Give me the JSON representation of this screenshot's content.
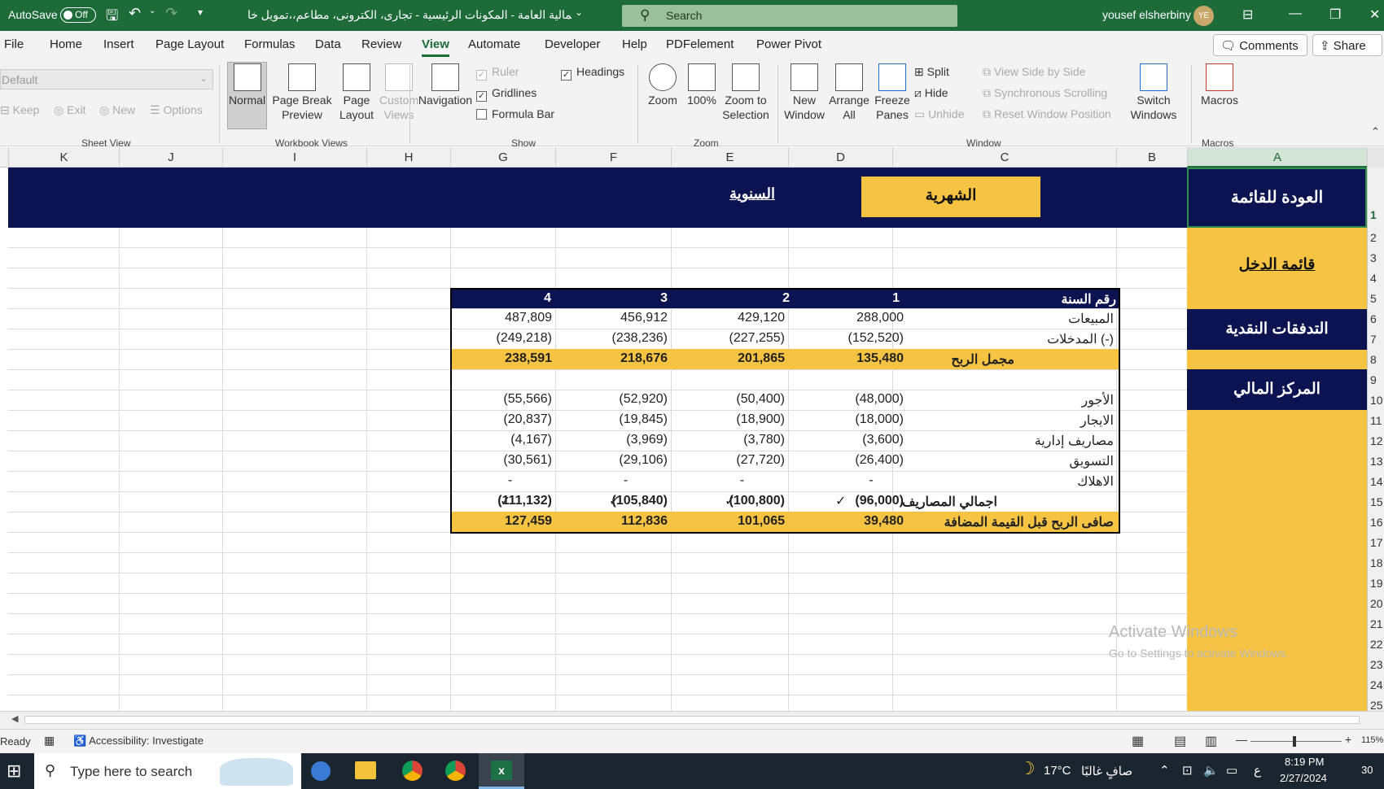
{
  "titlebar": {
    "autosave_label": "AutoSave",
    "autosave_state": "Off",
    "doc_title": "المالية العامة - المكونات الرئيسية - تجارى، الكترونى، مطاعم،،تمويل خا...",
    "search_placeholder": "Search",
    "user_name": "yousef elsherbiny",
    "user_initials": "YE"
  },
  "menu": {
    "tabs": [
      "File",
      "Home",
      "Insert",
      "Page Layout",
      "Formulas",
      "Data",
      "Review",
      "View",
      "Automate",
      "Developer",
      "Help",
      "PDFelement",
      "Power Pivot"
    ],
    "active_tab": "View",
    "comments_label": "Comments",
    "share_label": "Share"
  },
  "ribbon": {
    "sheet_view": {
      "dropdown_value": "Default",
      "keep": "Keep",
      "exit": "Exit",
      "new": "New",
      "options": "Options",
      "group": "Sheet View"
    },
    "workbook_views": {
      "normal": "Normal",
      "page_break": "Page Break\nPreview",
      "page_layout": "Page\nLayout",
      "custom_views": "Custom\nViews",
      "group": "Workbook Views"
    },
    "show": {
      "navigation": "Navigation",
      "ruler": "Ruler",
      "gridlines": "Gridlines",
      "formula_bar": "Formula Bar",
      "headings": "Headings",
      "group": "Show"
    },
    "zoom": {
      "zoom": "Zoom",
      "zoom100": "100%",
      "zoom_sel": "Zoom to\nSelection",
      "group": "Zoom"
    },
    "window": {
      "new_window": "New\nWindow",
      "arrange_all": "Arrange\nAll",
      "freeze": "Freeze\nPanes",
      "split": "Split",
      "hide": "Hide",
      "unhide": "Unhide",
      "side_by_side": "View Side by Side",
      "sync_scroll": "Synchronous Scrolling",
      "reset_pos": "Reset Window Position",
      "switch": "Switch\nWindows",
      "group": "Window"
    },
    "macros": {
      "macros": "Macros",
      "group": "Macros"
    }
  },
  "columns": [
    "K",
    "J",
    "I",
    "H",
    "G",
    "F",
    "E",
    "D",
    "C",
    "B",
    "A"
  ],
  "rows": [
    "1",
    "2",
    "3",
    "4",
    "5",
    "6",
    "7",
    "8",
    "9",
    "10",
    "11",
    "12",
    "13",
    "14",
    "15",
    "16",
    "17",
    "18",
    "19",
    "20",
    "21",
    "22",
    "23",
    "24",
    "25"
  ],
  "sheet": {
    "back_to_list": "العودة للقائمة",
    "monthly": "الشهرية",
    "annual": "السنوية",
    "nav_income": "قائمة الدخل",
    "nav_cashflow": "التدفقات النقدية",
    "nav_position": "المركز المالي"
  },
  "table": {
    "header_label": "رقم السنة",
    "years": [
      "1",
      "2",
      "3",
      "4"
    ],
    "rows": [
      {
        "label": "المبيعات",
        "values": [
          "288,000",
          "429,120",
          "456,912",
          "487,809"
        ],
        "style": "normal"
      },
      {
        "label": "المدخلات (-)",
        "values": [
          "(152,520)",
          "(227,255)",
          "(238,236)",
          "(249,218)"
        ],
        "style": "normal"
      },
      {
        "label": "مجمل الربح",
        "values": [
          "135,480",
          "201,865",
          "218,676",
          "238,591"
        ],
        "style": "highlight"
      },
      {
        "label": "",
        "values": [
          "",
          "",
          "",
          ""
        ],
        "style": "blank"
      },
      {
        "label": "الأجور",
        "values": [
          "(48,000)",
          "(50,400)",
          "(52,920)",
          "(55,566)"
        ],
        "style": "normal"
      },
      {
        "label": "الايجار",
        "values": [
          "(18,000)",
          "(18,900)",
          "(19,845)",
          "(20,837)"
        ],
        "style": "normal"
      },
      {
        "label": "مصاريف إدارية",
        "values": [
          "(3,600)",
          "(3,780)",
          "(3,969)",
          "(4,167)"
        ],
        "style": "normal"
      },
      {
        "label": "التسويق",
        "values": [
          "(26,400)",
          "(27,720)",
          "(29,106)",
          "(30,561)"
        ],
        "style": "normal"
      },
      {
        "label": "الاهلاك",
        "values": [
          "-",
          "-",
          "-",
          "-"
        ],
        "style": "normal"
      },
      {
        "label": "اجمالي المصاريف",
        "values": [
          "(96,000)",
          "(100,800)",
          "(105,840)",
          "(111,132)"
        ],
        "style": "bold"
      },
      {
        "label": "صافى  الربح قبل القيمة المضافة",
        "values": [
          "39,480",
          "101,065",
          "112,836",
          "127,459"
        ],
        "style": "highlight"
      }
    ],
    "checks": [
      "✓",
      "✓",
      "✓",
      "✓"
    ]
  },
  "activate": {
    "line1": "Activate Windows",
    "line2": "Go to Settings to activate Windows."
  },
  "status": {
    "ready": "Ready",
    "accessibility": "Accessibility: Investigate",
    "zoom": "115%"
  },
  "taskbar": {
    "search_placeholder": "Type here to search",
    "weather_temp": "17°C",
    "weather_text": "صافٍ غالبًا",
    "lang": "ع",
    "time": "8:19 PM",
    "date": "2/27/2024",
    "notif": "30"
  },
  "colors": {
    "excel_green": "#1e6b3a",
    "navy": "#0b1451",
    "gold": "#f6c343"
  },
  "icons": [
    "save-icon",
    "undo-icon",
    "redo-icon",
    "search-icon",
    "windows-logo-icon",
    "chrome-icon",
    "excel-icon",
    "folder-icon"
  ]
}
